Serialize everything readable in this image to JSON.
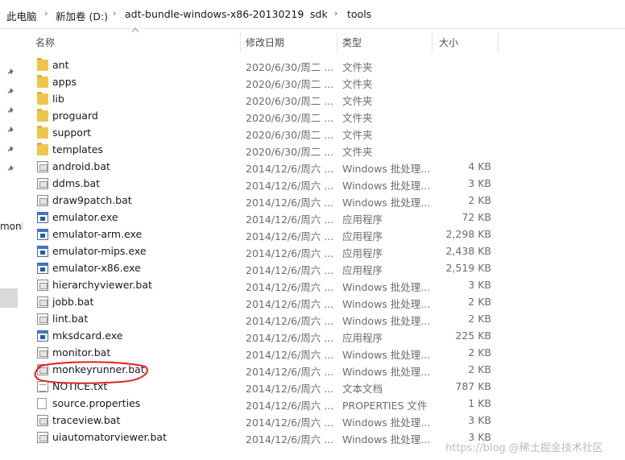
{
  "breadcrumb": {
    "items": [
      "此电脑",
      "新加卷 (D:)",
      "adt-bundle-windows-x86-20130219",
      "sdk",
      "tools"
    ],
    "separator": "›"
  },
  "nav": {
    "pinned_icon": "pin-icon",
    "fragment_text": "monk"
  },
  "columns": {
    "name": "名称",
    "date": "修改日期",
    "type": "类型",
    "size": "大小"
  },
  "files": [
    {
      "name": "ant",
      "date": "2020/6/30/周二 ...",
      "type": "文件夹",
      "size": "",
      "icon": "folder-icon"
    },
    {
      "name": "apps",
      "date": "2020/6/30/周二 ...",
      "type": "文件夹",
      "size": "",
      "icon": "folder-icon"
    },
    {
      "name": "lib",
      "date": "2020/6/30/周二 ...",
      "type": "文件夹",
      "size": "",
      "icon": "folder-icon"
    },
    {
      "name": "proguard",
      "date": "2020/6/30/周二 ...",
      "type": "文件夹",
      "size": "",
      "icon": "folder-icon"
    },
    {
      "name": "support",
      "date": "2020/6/30/周二 ...",
      "type": "文件夹",
      "size": "",
      "icon": "folder-icon"
    },
    {
      "name": "templates",
      "date": "2020/6/30/周二 ...",
      "type": "文件夹",
      "size": "",
      "icon": "folder-icon"
    },
    {
      "name": "android.bat",
      "date": "2014/12/6/周六 ...",
      "type": "Windows 批处理...",
      "size": "4 KB",
      "icon": "batch-file-icon"
    },
    {
      "name": "ddms.bat",
      "date": "2014/12/6/周六 ...",
      "type": "Windows 批处理...",
      "size": "3 KB",
      "icon": "batch-file-icon"
    },
    {
      "name": "draw9patch.bat",
      "date": "2014/12/6/周六 ...",
      "type": "Windows 批处理...",
      "size": "2 KB",
      "icon": "batch-file-icon"
    },
    {
      "name": "emulator.exe",
      "date": "2014/12/6/周六 ...",
      "type": "应用程序",
      "size": "72 KB",
      "icon": "application-icon"
    },
    {
      "name": "emulator-arm.exe",
      "date": "2014/12/6/周六 ...",
      "type": "应用程序",
      "size": "2,298 KB",
      "icon": "application-icon"
    },
    {
      "name": "emulator-mips.exe",
      "date": "2014/12/6/周六 ...",
      "type": "应用程序",
      "size": "2,438 KB",
      "icon": "application-icon"
    },
    {
      "name": "emulator-x86.exe",
      "date": "2014/12/6/周六 ...",
      "type": "应用程序",
      "size": "2,519 KB",
      "icon": "application-icon"
    },
    {
      "name": "hierarchyviewer.bat",
      "date": "2014/12/6/周六 ...",
      "type": "Windows 批处理...",
      "size": "3 KB",
      "icon": "batch-file-icon"
    },
    {
      "name": "jobb.bat",
      "date": "2014/12/6/周六 ...",
      "type": "Windows 批处理...",
      "size": "2 KB",
      "icon": "batch-file-icon"
    },
    {
      "name": "lint.bat",
      "date": "2014/12/6/周六 ...",
      "type": "Windows 批处理...",
      "size": "2 KB",
      "icon": "batch-file-icon"
    },
    {
      "name": "mksdcard.exe",
      "date": "2014/12/6/周六 ...",
      "type": "应用程序",
      "size": "225 KB",
      "icon": "application-icon"
    },
    {
      "name": "monitor.bat",
      "date": "2014/12/6/周六 ...",
      "type": "Windows 批处理...",
      "size": "2 KB",
      "icon": "batch-file-icon"
    },
    {
      "name": "monkeyrunner.bat",
      "date": "2014/12/6/周六 ...",
      "type": "Windows 批处理...",
      "size": "2 KB",
      "icon": "batch-file-icon"
    },
    {
      "name": "NOTICE.txt",
      "date": "2014/12/6/周六 ...",
      "type": "文本文档",
      "size": "787 KB",
      "icon": "text-file-icon"
    },
    {
      "name": "source.properties",
      "date": "2014/12/6/周六 ...",
      "type": "PROPERTIES 文件",
      "size": "1 KB",
      "icon": "generic-file-icon"
    },
    {
      "name": "traceview.bat",
      "date": "2014/12/6/周六 ...",
      "type": "Windows 批处理...",
      "size": "3 KB",
      "icon": "batch-file-icon"
    },
    {
      "name": "uiautomatorviewer.bat",
      "date": "2014/12/6/周六 ...",
      "type": "Windows 批处理...",
      "size": "3 KB",
      "icon": "batch-file-icon"
    }
  ],
  "annotation": {
    "highlighted_file": "monkeyrunner.bat",
    "color": "#e02020"
  },
  "watermark": "https://blog @稀土掘金技术社区",
  "colors": {
    "folder": "#f0c64a",
    "annotation": "#e02020",
    "text_secondary": "#6d6d6d"
  }
}
